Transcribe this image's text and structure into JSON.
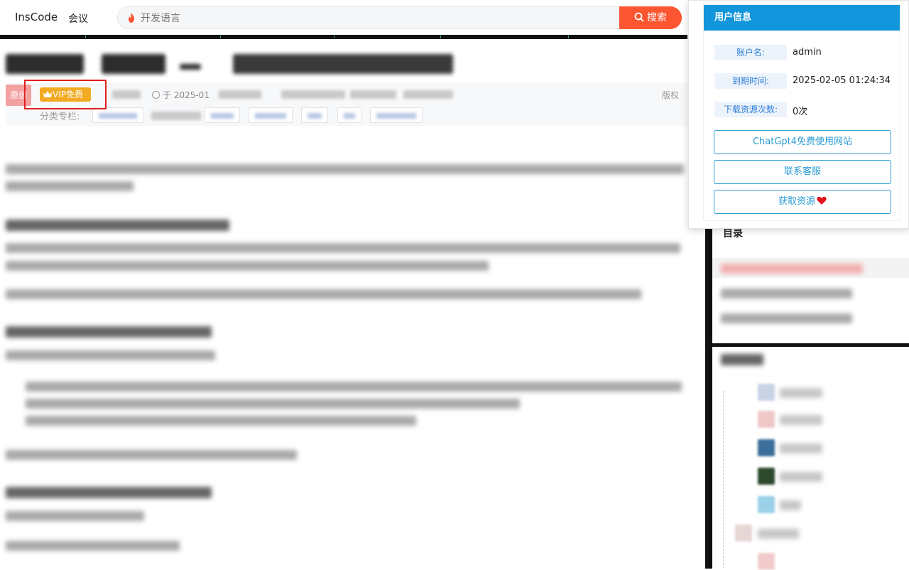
{
  "nav": {
    "brand": "InsCode",
    "meeting": "会议",
    "search_placeholder": "开发语言",
    "search_button": "搜索"
  },
  "article": {
    "tag_original": "原创",
    "vip_label": "VIP免费",
    "date_prefix": "于 2025-01",
    "copyright": "版权",
    "category_label": "分类专栏:"
  },
  "sidebar": {
    "toc_title": "目录"
  },
  "user_info": {
    "title": "用户信息",
    "account_label": "账户名:",
    "account_value": "admin",
    "expire_label": "到期时间:",
    "expire_value": "2025-02-05 01:24:34",
    "download_label": "下载资源次数:",
    "download_value": "0次",
    "btn_chatgpt": "ChatGpt4免费使用网站",
    "btn_support": "联系客服",
    "btn_resource": "获取资源"
  },
  "colors": {
    "accent_orange": "#fc5531",
    "header_blue": "#1296db",
    "vip_gold": "#f2aa22",
    "highlight_red": "#e02020"
  }
}
